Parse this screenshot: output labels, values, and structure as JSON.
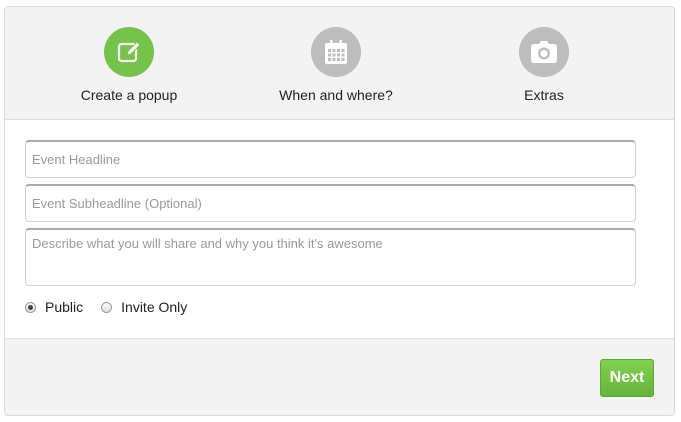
{
  "steps": [
    {
      "label": "Create a popup",
      "icon": "edit-icon",
      "state": "active"
    },
    {
      "label": "When and where?",
      "icon": "calendar-icon",
      "state": "inactive"
    },
    {
      "label": "Extras",
      "icon": "camera-icon",
      "state": "inactive"
    }
  ],
  "form": {
    "headline_placeholder": "Event Headline",
    "subheadline_placeholder": "Event Subheadline (Optional)",
    "description_placeholder": "Describe what you will share and why you think it's awesome",
    "visibility": {
      "options": [
        "Public",
        "Invite Only"
      ],
      "selected": "Public"
    }
  },
  "footer": {
    "next_label": "Next"
  },
  "colors": {
    "accent": "#76c34b",
    "inactive_step": "#bdbdbd",
    "panel_bg": "#f3f3f3"
  }
}
